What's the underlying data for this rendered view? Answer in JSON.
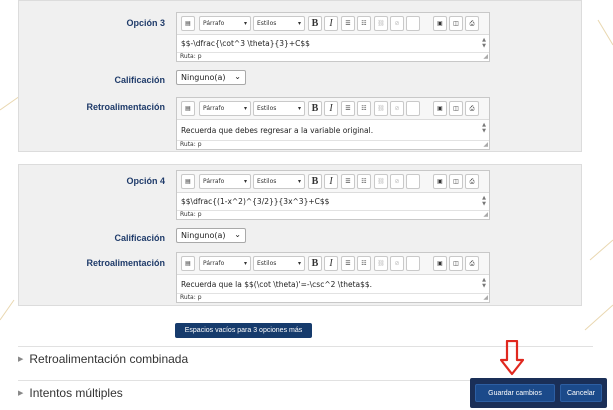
{
  "editor_toolbar": {
    "paragraph_select": "Párrafo",
    "styles_select": "Estilos",
    "bold": "B",
    "italic": "I",
    "path_prefix": "Ruta:",
    "path_value": "p"
  },
  "option3": {
    "label": "Opción 3",
    "answer_text": "$$-\\dfrac{\\cot^3 \\theta}{3}+C$$",
    "grade_label": "Calificación",
    "grade_value": "Ninguno(a)",
    "feedback_label": "Retroalimentación",
    "feedback_text": "Recuerda que debes regresar a la variable original."
  },
  "option4": {
    "label": "Opción 4",
    "answer_text": "$$\\dfrac{(1-x^2)^{3/2}}{3x^3}+C$$",
    "grade_label": "Calificación",
    "grade_value": "Ninguno(a)",
    "feedback_label": "Retroalimentación",
    "feedback_text": "Recuerda que la $$(\\cot \\theta)'=-\\csc^2 \\theta$$."
  },
  "blank_slots_button": "Espacios vacíos para  3 opciones más",
  "sections": {
    "combined_feedback": "Retroalimentación combinada",
    "multiple_tries": "Intentos múltiples"
  },
  "actions": {
    "save": "Guardar cambios",
    "cancel": "Cancelar"
  },
  "colors": {
    "accent": "#163b6c",
    "label": "#1f3b6a",
    "arrow": "#e0281f"
  }
}
